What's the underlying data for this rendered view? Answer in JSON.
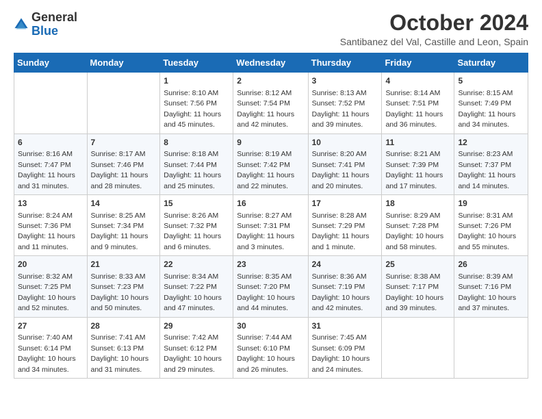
{
  "header": {
    "logo_general": "General",
    "logo_blue": "Blue",
    "title": "October 2024",
    "subtitle": "Santibanez del Val, Castille and Leon, Spain"
  },
  "weekdays": [
    "Sunday",
    "Monday",
    "Tuesday",
    "Wednesday",
    "Thursday",
    "Friday",
    "Saturday"
  ],
  "weeks": [
    [
      {
        "day": "",
        "detail": ""
      },
      {
        "day": "",
        "detail": ""
      },
      {
        "day": "1",
        "detail": "Sunrise: 8:10 AM\nSunset: 7:56 PM\nDaylight: 11 hours and 45 minutes."
      },
      {
        "day": "2",
        "detail": "Sunrise: 8:12 AM\nSunset: 7:54 PM\nDaylight: 11 hours and 42 minutes."
      },
      {
        "day": "3",
        "detail": "Sunrise: 8:13 AM\nSunset: 7:52 PM\nDaylight: 11 hours and 39 minutes."
      },
      {
        "day": "4",
        "detail": "Sunrise: 8:14 AM\nSunset: 7:51 PM\nDaylight: 11 hours and 36 minutes."
      },
      {
        "day": "5",
        "detail": "Sunrise: 8:15 AM\nSunset: 7:49 PM\nDaylight: 11 hours and 34 minutes."
      }
    ],
    [
      {
        "day": "6",
        "detail": "Sunrise: 8:16 AM\nSunset: 7:47 PM\nDaylight: 11 hours and 31 minutes."
      },
      {
        "day": "7",
        "detail": "Sunrise: 8:17 AM\nSunset: 7:46 PM\nDaylight: 11 hours and 28 minutes."
      },
      {
        "day": "8",
        "detail": "Sunrise: 8:18 AM\nSunset: 7:44 PM\nDaylight: 11 hours and 25 minutes."
      },
      {
        "day": "9",
        "detail": "Sunrise: 8:19 AM\nSunset: 7:42 PM\nDaylight: 11 hours and 22 minutes."
      },
      {
        "day": "10",
        "detail": "Sunrise: 8:20 AM\nSunset: 7:41 PM\nDaylight: 11 hours and 20 minutes."
      },
      {
        "day": "11",
        "detail": "Sunrise: 8:21 AM\nSunset: 7:39 PM\nDaylight: 11 hours and 17 minutes."
      },
      {
        "day": "12",
        "detail": "Sunrise: 8:23 AM\nSunset: 7:37 PM\nDaylight: 11 hours and 14 minutes."
      }
    ],
    [
      {
        "day": "13",
        "detail": "Sunrise: 8:24 AM\nSunset: 7:36 PM\nDaylight: 11 hours and 11 minutes."
      },
      {
        "day": "14",
        "detail": "Sunrise: 8:25 AM\nSunset: 7:34 PM\nDaylight: 11 hours and 9 minutes."
      },
      {
        "day": "15",
        "detail": "Sunrise: 8:26 AM\nSunset: 7:32 PM\nDaylight: 11 hours and 6 minutes."
      },
      {
        "day": "16",
        "detail": "Sunrise: 8:27 AM\nSunset: 7:31 PM\nDaylight: 11 hours and 3 minutes."
      },
      {
        "day": "17",
        "detail": "Sunrise: 8:28 AM\nSunset: 7:29 PM\nDaylight: 11 hours and 1 minute."
      },
      {
        "day": "18",
        "detail": "Sunrise: 8:29 AM\nSunset: 7:28 PM\nDaylight: 10 hours and 58 minutes."
      },
      {
        "day": "19",
        "detail": "Sunrise: 8:31 AM\nSunset: 7:26 PM\nDaylight: 10 hours and 55 minutes."
      }
    ],
    [
      {
        "day": "20",
        "detail": "Sunrise: 8:32 AM\nSunset: 7:25 PM\nDaylight: 10 hours and 52 minutes."
      },
      {
        "day": "21",
        "detail": "Sunrise: 8:33 AM\nSunset: 7:23 PM\nDaylight: 10 hours and 50 minutes."
      },
      {
        "day": "22",
        "detail": "Sunrise: 8:34 AM\nSunset: 7:22 PM\nDaylight: 10 hours and 47 minutes."
      },
      {
        "day": "23",
        "detail": "Sunrise: 8:35 AM\nSunset: 7:20 PM\nDaylight: 10 hours and 44 minutes."
      },
      {
        "day": "24",
        "detail": "Sunrise: 8:36 AM\nSunset: 7:19 PM\nDaylight: 10 hours and 42 minutes."
      },
      {
        "day": "25",
        "detail": "Sunrise: 8:38 AM\nSunset: 7:17 PM\nDaylight: 10 hours and 39 minutes."
      },
      {
        "day": "26",
        "detail": "Sunrise: 8:39 AM\nSunset: 7:16 PM\nDaylight: 10 hours and 37 minutes."
      }
    ],
    [
      {
        "day": "27",
        "detail": "Sunrise: 7:40 AM\nSunset: 6:14 PM\nDaylight: 10 hours and 34 minutes."
      },
      {
        "day": "28",
        "detail": "Sunrise: 7:41 AM\nSunset: 6:13 PM\nDaylight: 10 hours and 31 minutes."
      },
      {
        "day": "29",
        "detail": "Sunrise: 7:42 AM\nSunset: 6:12 PM\nDaylight: 10 hours and 29 minutes."
      },
      {
        "day": "30",
        "detail": "Sunrise: 7:44 AM\nSunset: 6:10 PM\nDaylight: 10 hours and 26 minutes."
      },
      {
        "day": "31",
        "detail": "Sunrise: 7:45 AM\nSunset: 6:09 PM\nDaylight: 10 hours and 24 minutes."
      },
      {
        "day": "",
        "detail": ""
      },
      {
        "day": "",
        "detail": ""
      }
    ]
  ]
}
